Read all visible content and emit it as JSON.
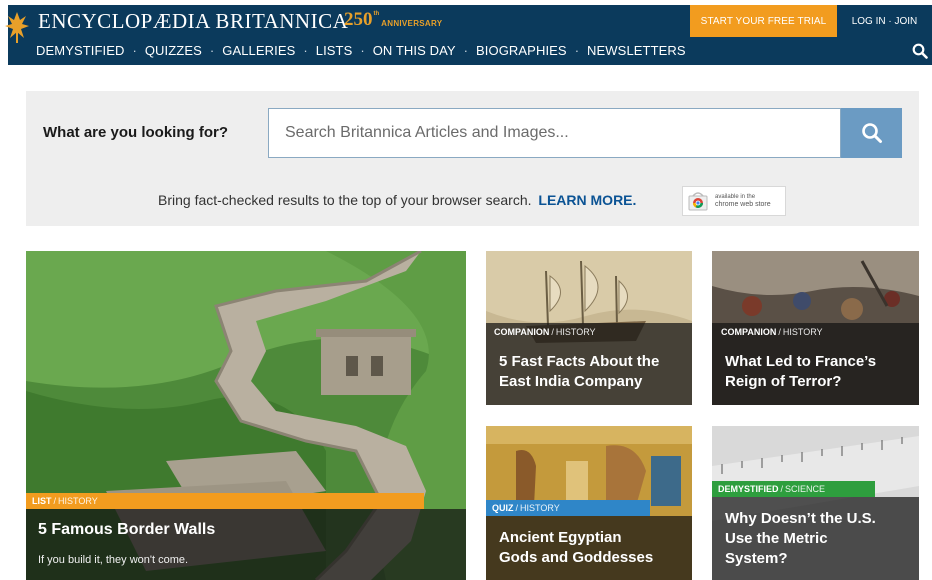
{
  "header": {
    "brand": "ENCYCLOPÆDIA BRITANNICA",
    "anniversary_num": "250",
    "anniversary_suffix": "th",
    "anniversary_text": "ANNIVERSARY",
    "trial_button": "START YOUR FREE TRIAL",
    "login_button": "LOG IN · JOIN",
    "nav": [
      "DEMYSTIFIED",
      "QUIZZES",
      "GALLERIES",
      "LISTS",
      "ON THIS DAY",
      "BIOGRAPHIES",
      "NEWSLETTERS"
    ],
    "nav_separator": "·",
    "colors": {
      "bar": "#0b3a5c",
      "accent": "#f29c1f",
      "anniversary": "#e8a02a"
    }
  },
  "search": {
    "question": "What are you looking for?",
    "placeholder": "Search Britannica Articles and Images...",
    "button_icon": "search-icon",
    "promo_text": "Bring fact-checked results to the top of your browser search.",
    "promo_link": "LEARN MORE.",
    "chrome_badge_line1": "available in the",
    "chrome_badge_line2": "chrome web store"
  },
  "cards": [
    {
      "category": "LIST",
      "section": "HISTORY",
      "title": "5 Famous Border Walls",
      "subtitle": "If you build it, they won't come.",
      "tag_color": "#f29c1f"
    },
    {
      "category": "COMPANION",
      "section": "HISTORY",
      "title_line1": "5 Fast Facts About the",
      "title_line2": "East India Company"
    },
    {
      "category": "COMPANION",
      "section": "HISTORY",
      "title_line1": "What Led to France’s",
      "title_line2": "Reign of Terror?"
    },
    {
      "category": "QUIZ",
      "section": "HISTORY",
      "title_line1": "Ancient Egyptian",
      "title_line2": "Gods and Goddesses",
      "tag_color": "#2f86c8"
    },
    {
      "category": "DEMYSTIFIED",
      "section": "SCIENCE",
      "title_line1": "Why Doesn’t the U.S.",
      "title_line2": "Use the Metric",
      "title_line3": "System?",
      "tag_color": "#2e9e3e"
    }
  ],
  "tag_divider": "/"
}
